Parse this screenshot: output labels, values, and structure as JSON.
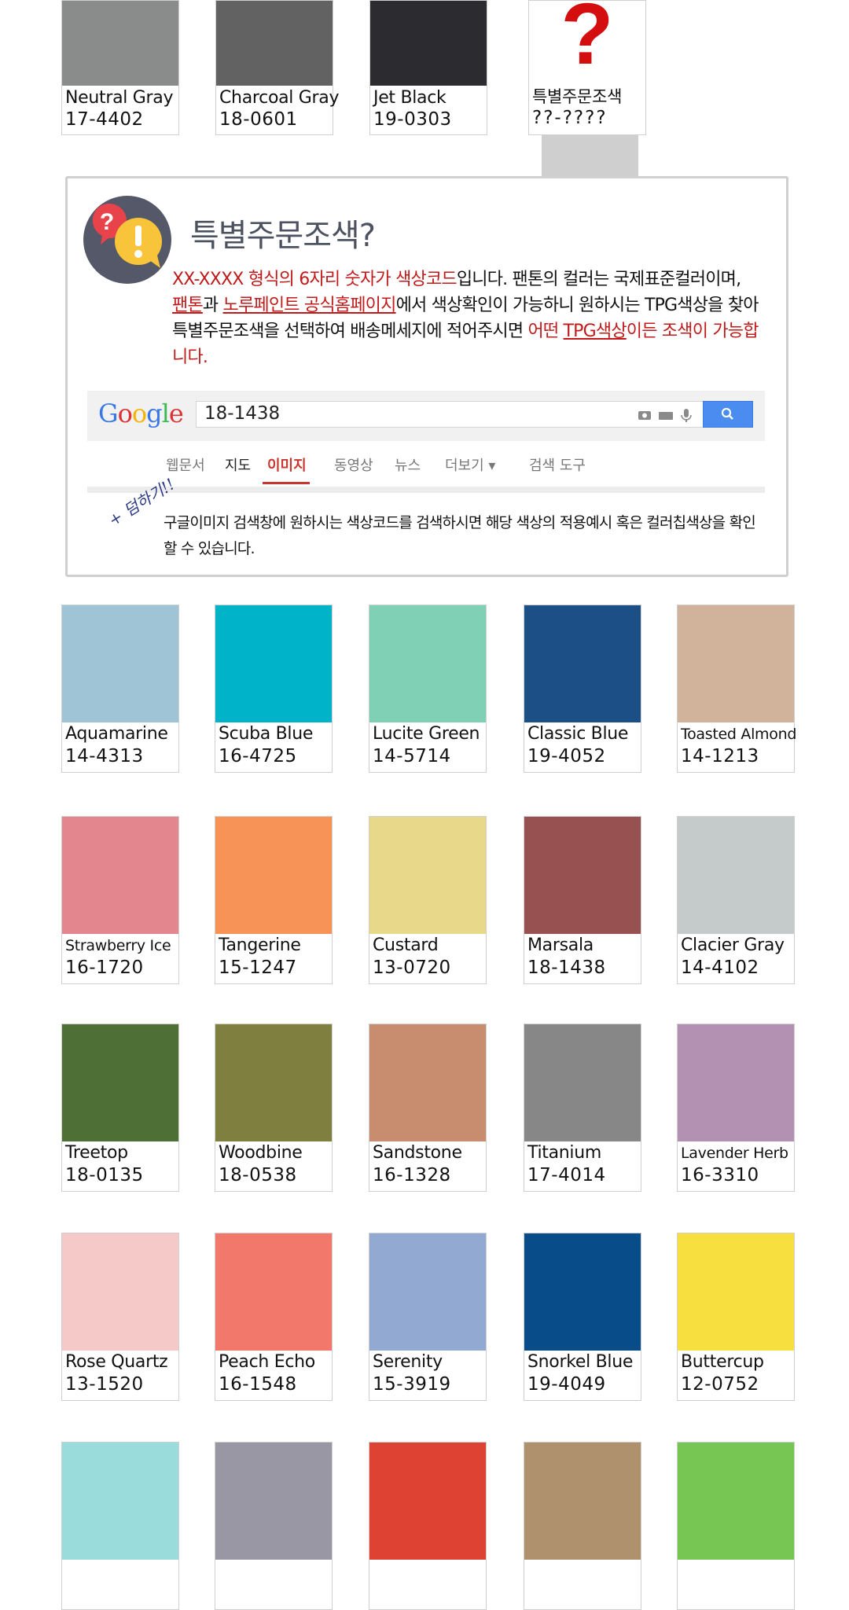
{
  "top_row": [
    {
      "name": "Neutral Gray",
      "code": "17-4402",
      "color": "#898c8b"
    },
    {
      "name": "Charcoal Gray",
      "code": "18-0601",
      "color": "#626262"
    },
    {
      "name": "Jet Black",
      "code": "19-0303",
      "color": "#2c2b30"
    },
    {
      "name": "특별주문조색",
      "code": "??-????",
      "symbol": "?",
      "symbol_color": "#d40e0e"
    }
  ],
  "info_box": {
    "title": "특별주문조색?",
    "icon": "question-exclamation-bubbles-icon",
    "text_1_red": "XX-XXXX 형식의 6자리 숫자가 색상코드",
    "text_2": "입니다. 팬톤의 컬러는 국제표준컬러이며,",
    "text_3_red_link": "팬톤",
    "text_4": "과 ",
    "text_5_red_link": "노루페인트 공식홈페이지",
    "text_6": "에서 색상확인이 가능하니 원하시는 TPG색상을 찾아 특별주문조색을 선택하여 배송메세지에 적어주시면 ",
    "text_7_red": "어떤 ",
    "text_8_red_link": "TPG색상",
    "text_9_red": "이든 조색이 가능합니다.",
    "google": {
      "logo": "Google",
      "query": "18-1438",
      "tabs": [
        "웹문서",
        "지도",
        "이미지",
        "동영상",
        "뉴스",
        "더보기 ▾",
        "검색 도구"
      ],
      "active_tab": "이미지"
    },
    "handwriting": "+ 덤하기!!",
    "note": "구글이미지 검색창에 원하시는 색상코드를 검색하시면 해당 색상의 적용예시 혹은  컬러칩색상을 확인할 수 있습니다."
  },
  "swatches": [
    {
      "name": "Aquamarine",
      "code": "14-4313",
      "color": "#9fc4d6"
    },
    {
      "name": "Scuba Blue",
      "code": "16-4725",
      "color": "#00b3c9"
    },
    {
      "name": "Lucite Green",
      "code": "14-5714",
      "color": "#7fd0b4"
    },
    {
      "name": "Classic Blue",
      "code": "19-4052",
      "color": "#1d4f87"
    },
    {
      "name": "Toasted Almond",
      "code": "14-1213",
      "color": "#d1b29a"
    },
    {
      "name": "Strawberry Ice",
      "code": "16-1720",
      "color": "#e3868e"
    },
    {
      "name": "Tangerine",
      "code": "15-1247",
      "color": "#f79357"
    },
    {
      "name": "Custard",
      "code": "13-0720",
      "color": "#e8d98a"
    },
    {
      "name": "Marsala",
      "code": "18-1438",
      "color": "#985151"
    },
    {
      "name": "Clacier Gray",
      "code": "14-4102",
      "color": "#c5cbca"
    },
    {
      "name": "Treetop",
      "code": "18-0135",
      "color": "#4e7036"
    },
    {
      "name": "Woodbine",
      "code": "18-0538",
      "color": "#7f7f40"
    },
    {
      "name": "Sandstone",
      "code": "16-1328",
      "color": "#c88c6e"
    },
    {
      "name": "Titanium",
      "code": "17-4014",
      "color": "#878788"
    },
    {
      "name": "Lavender Herb",
      "code": "16-3310",
      "color": "#b391b2"
    },
    {
      "name": "Rose Quartz",
      "code": "13-1520",
      "color": "#f5c9c8"
    },
    {
      "name": "Peach Echo",
      "code": "16-1548",
      "color": "#f1786b"
    },
    {
      "name": "Serenity",
      "code": "15-3919",
      "color": "#92a9d2"
    },
    {
      "name": "Snorkel Blue",
      "code": "19-4049",
      "color": "#084d89"
    },
    {
      "name": "Buttercup",
      "code": "12-0752",
      "color": "#f8df40"
    },
    {
      "name": "",
      "code": "",
      "color": "#9adbdb"
    },
    {
      "name": "",
      "code": "",
      "color": "#9997a4"
    },
    {
      "name": "",
      "code": "",
      "color": "#de4233"
    },
    {
      "name": "",
      "code": "",
      "color": "#b0916d"
    },
    {
      "name": "",
      "code": "",
      "color": "#77c653"
    }
  ]
}
